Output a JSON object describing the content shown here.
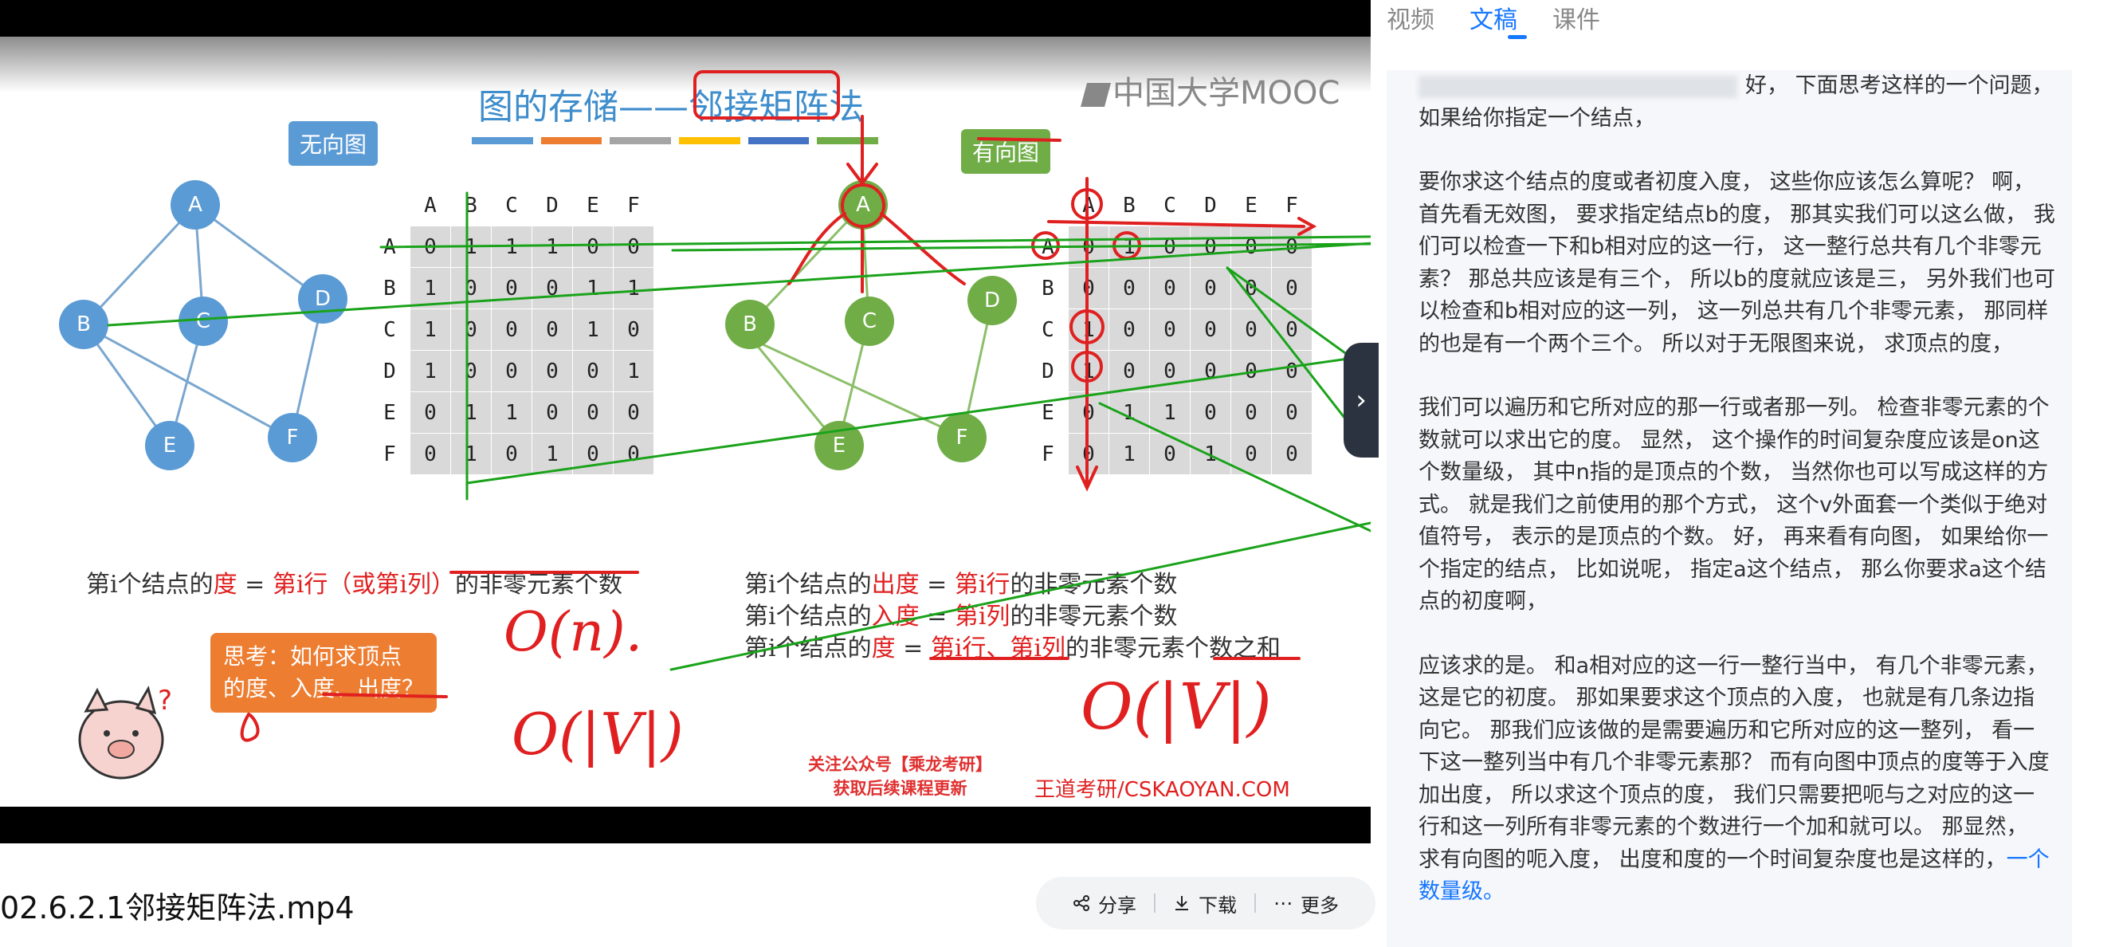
{
  "tabs": {
    "items": [
      "视频",
      "文稿",
      "课件"
    ],
    "active": "文稿"
  },
  "video": {
    "filename": "02.6.2.1邻接矩阵法.mp4",
    "slide": {
      "title": "图的存储——邻接矩阵法",
      "mooc_logo": "中国大学MOOC",
      "undirected_label": "无向图",
      "directed_label": "有向图",
      "nodes": [
        "A",
        "B",
        "C",
        "D",
        "E",
        "F"
      ],
      "col_headers": [
        "A",
        "B",
        "C",
        "D",
        "E",
        "F"
      ],
      "undirected_matrix": [
        [
          0,
          1,
          1,
          1,
          0,
          0
        ],
        [
          1,
          0,
          0,
          0,
          1,
          1
        ],
        [
          1,
          0,
          0,
          0,
          1,
          0
        ],
        [
          1,
          0,
          0,
          0,
          0,
          1
        ],
        [
          0,
          1,
          1,
          0,
          0,
          0
        ],
        [
          0,
          1,
          0,
          1,
          0,
          0
        ]
      ],
      "directed_matrix": [
        [
          0,
          1,
          0,
          0,
          0,
          0
        ],
        [
          0,
          0,
          0,
          0,
          0,
          0
        ],
        [
          1,
          0,
          0,
          0,
          0,
          0
        ],
        [
          1,
          0,
          0,
          0,
          0,
          0
        ],
        [
          0,
          1,
          1,
          0,
          0,
          0
        ],
        [
          0,
          1,
          0,
          1,
          0,
          0
        ]
      ],
      "formula_undirected": {
        "prefix": "第i个结点的",
        "deg": "度",
        "eq": " = ",
        "row": "第i行（或第i列）",
        "suffix": "的非零元素个数"
      },
      "formula_out": {
        "prefix": "第i个结点的",
        "deg": "出度",
        "eq": " = ",
        "row": "第i行",
        "suffix": "的非零元素个数"
      },
      "formula_in": {
        "prefix": "第i个结点的",
        "deg": "入度",
        "eq": " = ",
        "row": "第i列",
        "suffix": "的非零元素个数"
      },
      "formula_total": {
        "prefix": "第i个结点的",
        "deg": "度",
        "eq": " = ",
        "row": "第i行、第i列",
        "suffix": "的非零元素个数之和"
      },
      "think_box": [
        "思考：如何求顶点",
        "的度、入度、出度？"
      ],
      "handwriting": [
        "O(n).",
        "O(|V|)",
        "O(|V|)"
      ],
      "promo": [
        "关注公众号【乘龙考研】",
        "获取后续课程更新"
      ],
      "watermark": "王道考研/CSKAOYAN.COM",
      "colors": {
        "blue": "#5b9bd5",
        "green": "#70ad47",
        "orange": "#ed7d31",
        "red_ink": "#e02020",
        "green_ink": "#1aa31a"
      }
    }
  },
  "actions": {
    "share": "分享",
    "download": "下载",
    "more": "更多"
  },
  "transcript": {
    "paragraphs": [
      "好， 下面思考这样的一个问题， 如果给你指定一个结点，",
      "要你求这个结点的度或者初度入度， 这些你应该怎么算呢？ 啊， 首先看无效图， 要求指定结点b的度， 那其实我们可以这么做， 我们可以检查一下和b相对应的这一行， 这一整行总共有几个非零元素？ 那总共应该是有三个， 所以b的度就应该是三， 另外我们也可以检查和b相对应的这一列， 这一列总共有几个非零元素， 那同样的也是有一个两个三个。 所以对于无限图来说， 求顶点的度，",
      "我们可以遍历和它所对应的那一行或者那一列。 检查非零元素的个数就可以求出它的度。 显然， 这个操作的时间复杂度应该是on这个数量级， 其中n指的是顶点的个数， 当然你也可以写成这样的方式。 就是我们之前使用的那个方式， 这个v外面套一个类似于绝对值符号， 表示的是顶点的个数。 好， 再来看有向图， 如果给你一个指定的结点， 比如说呢， 指定a这个结点， 那么你要求a这个结点的初度啊，",
      "应该求的是。 和a相对应的这一行一整行当中， 有几个非零元素， 这是它的初度。 那如果要求这个顶点的入度， 也就是有几条边指向它。 那我们应该做的是需要遍历和它所对应的这一整列， 看一下这一整列当中有几个非零元素那？ 而有向图中顶点的度等于入度加出度， 所以求这个顶点的度， 我们只需要把呃与之对应的这一行和这一列所有非零元素的个数进行一个加和就可以。 那显然， 求有向图的呃入度， 出度和度的一个时间复杂度也是这样的，"
    ],
    "highlight": "一个数量级。"
  }
}
